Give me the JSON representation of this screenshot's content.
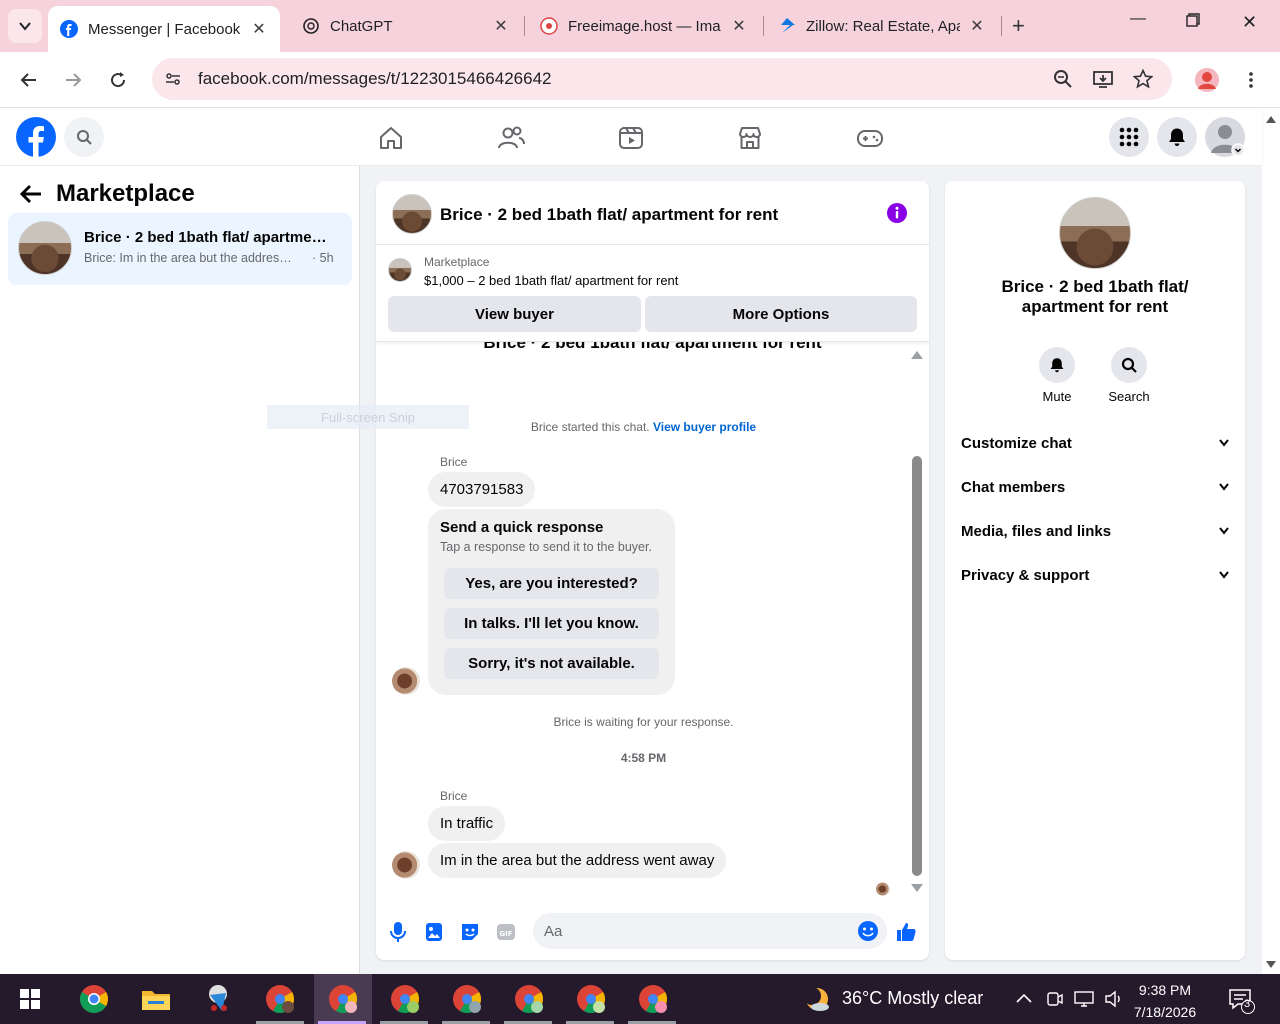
{
  "browser": {
    "tabs": [
      {
        "title": "Messenger | Facebook",
        "active": true
      },
      {
        "title": "ChatGPT",
        "active": false
      },
      {
        "title": "Freeimage.host — Ima",
        "active": false
      },
      {
        "title": "Zillow: Real Estate, Apa",
        "active": false
      }
    ],
    "url": "facebook.com/messages/t/1223015466426642"
  },
  "left": {
    "title": "Marketplace",
    "conversation": {
      "name": "Brice · 2 bed 1bath flat/ apartment...",
      "preview": "Brice: Im in the area but the address ...",
      "time": "· 5h"
    }
  },
  "snip_overlay": "Full-screen Snip",
  "chat": {
    "header_title": "Brice · 2 bed 1bath flat/ apartment for rent",
    "listing_label": "Marketplace",
    "listing_title": "$1,000 – 2 bed 1bath flat/ apartment for rent",
    "view_buyer": "View buyer",
    "more_options": "More Options",
    "cut_title": "Brice · 2 bed 1bath flat/ apartment for rent",
    "started_text": "Brice started this chat.",
    "view_profile": "View buyer profile",
    "sender1": "Brice",
    "msg_phone": "4703791583",
    "quick_title": "Send a quick response",
    "quick_sub": "Tap a response to send it to the buyer.",
    "quick_options": [
      "Yes, are you interested?",
      "In talks. I'll let you know.",
      "Sorry, it's not available."
    ],
    "waiting": "Brice is waiting for your response.",
    "timestamp": "4:58 PM",
    "sender2": "Brice",
    "msg2": "In traffic",
    "msg3": "Im in the area but the address went away",
    "composer_placeholder": "Aa"
  },
  "info": {
    "name": "Brice · 2 bed 1bath flat/ apartment for rent",
    "mute": "Mute",
    "search": "Search",
    "sections": [
      "Customize chat",
      "Chat members",
      "Media, files and links",
      "Privacy & support"
    ]
  },
  "taskbar": {
    "weather": "36°C  Mostly clear",
    "time": "9:38 PM",
    "date": "7/18/2026",
    "notifications": "3"
  },
  "colors": {
    "fb_blue": "#0866ff",
    "link_blue": "#0064d1",
    "info_purple": "#8a00e6",
    "tab_strip": "#f6d3dc"
  }
}
